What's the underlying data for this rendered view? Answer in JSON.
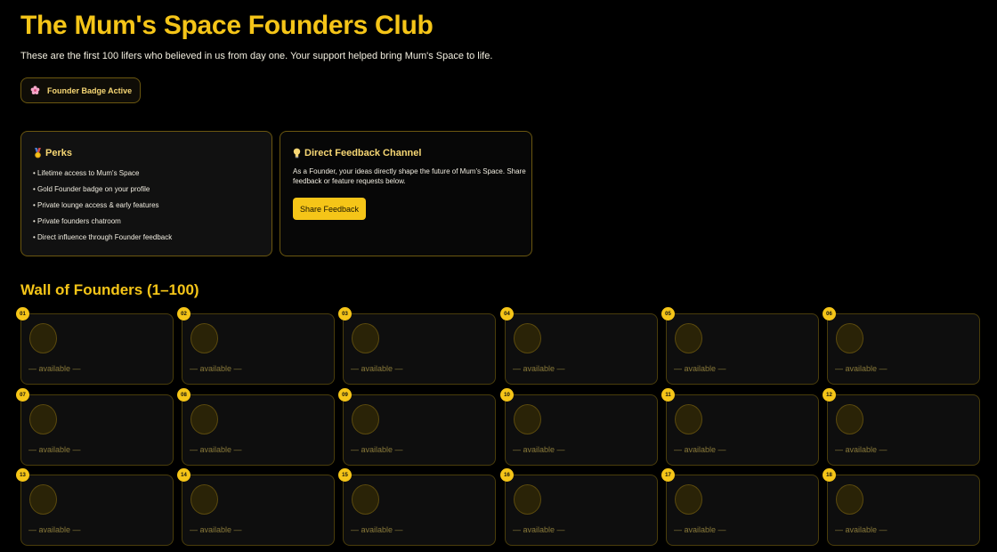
{
  "header": {
    "title": "The Mum's Space Founders Club",
    "subtitle": "These are the first 100 lifers who believed in us from day one. Your support helped bring Mum's Space to life.",
    "badge_label": "Founder Badge Active",
    "badge_icon": "cherry-blossom-icon"
  },
  "perks": {
    "title": "Perks",
    "icon": "medal-icon",
    "items": [
      "• Lifetime access to Mum's Space",
      "• Gold Founder badge on your profile",
      "• Private lounge access & early features",
      "• Private founders chatroom",
      "• Direct influence through Founder feedback"
    ]
  },
  "feedback": {
    "title": "Direct Feedback Channel",
    "icon": "lightbulb-icon",
    "text": "As a Founder, your ideas directly shape the future of Mum's Space. Share feedback or feature requests below.",
    "button_label": "Share Feedback"
  },
  "wall": {
    "title": "Wall of Founders (1–100)",
    "slots": [
      {
        "number": "01",
        "label": "— available —"
      },
      {
        "number": "02",
        "label": "— available —"
      },
      {
        "number": "03",
        "label": "— available —"
      },
      {
        "number": "04",
        "label": "— available —"
      },
      {
        "number": "05",
        "label": "— available —"
      },
      {
        "number": "06",
        "label": "— available —"
      },
      {
        "number": "07",
        "label": "— available —"
      },
      {
        "number": "08",
        "label": "— available —"
      },
      {
        "number": "09",
        "label": "— available —"
      },
      {
        "number": "10",
        "label": "— available —"
      },
      {
        "number": "11",
        "label": "— available —"
      },
      {
        "number": "12",
        "label": "— available —"
      },
      {
        "number": "13",
        "label": "— available —"
      },
      {
        "number": "14",
        "label": "— available —"
      },
      {
        "number": "15",
        "label": "— available —"
      },
      {
        "number": "16",
        "label": "— available —"
      },
      {
        "number": "17",
        "label": "— available —"
      },
      {
        "number": "18",
        "label": "— available —"
      }
    ]
  },
  "colors": {
    "accent": "#f5c518",
    "background": "#000000",
    "card_border": "#6b5710"
  }
}
